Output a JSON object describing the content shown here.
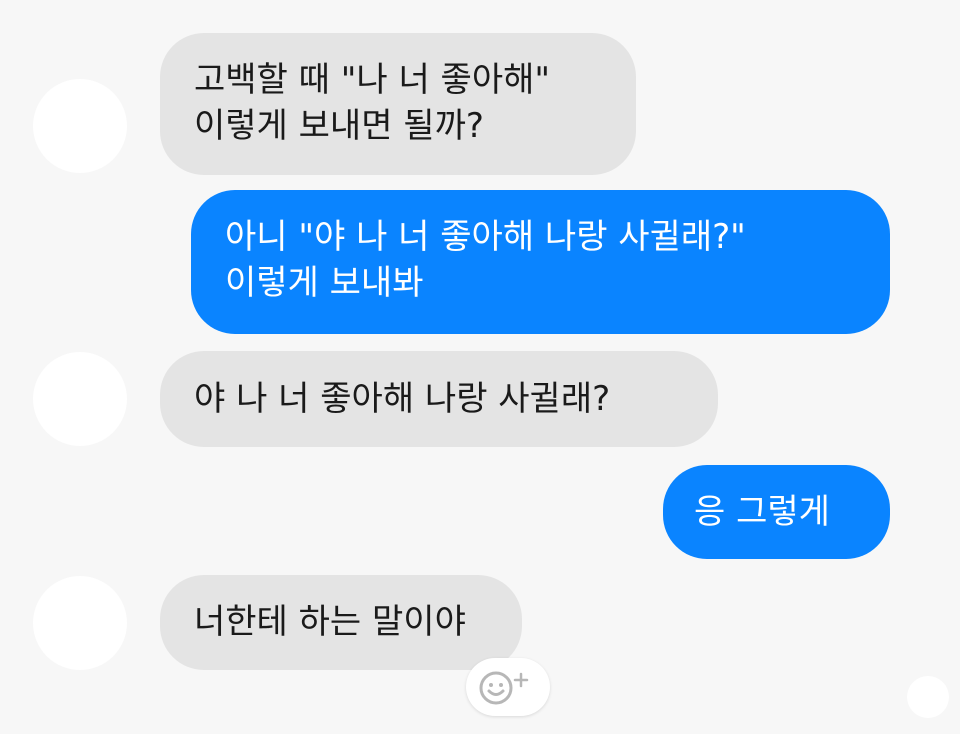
{
  "messages": [
    {
      "lines": [
        "고백할 때 \"나 너 좋아해\"",
        "이렇게 보내면 될까?"
      ]
    },
    {
      "lines": [
        "아니 \"야 나 너 좋아해 나랑 사귈래?\"",
        "이렇게 보내봐"
      ]
    },
    {
      "lines": [
        "야 나 너 좋아해 나랑 사귈래?"
      ]
    },
    {
      "lines": [
        "응 그렇게"
      ]
    },
    {
      "lines": [
        "너한테 하는 말이야"
      ]
    }
  ],
  "colors": {
    "background": "#f7f7f7",
    "incoming_bubble": "#e4e4e4",
    "outgoing_bubble": "#0a84ff"
  },
  "reaction_button": {
    "icon": "smiley-plus-icon"
  }
}
